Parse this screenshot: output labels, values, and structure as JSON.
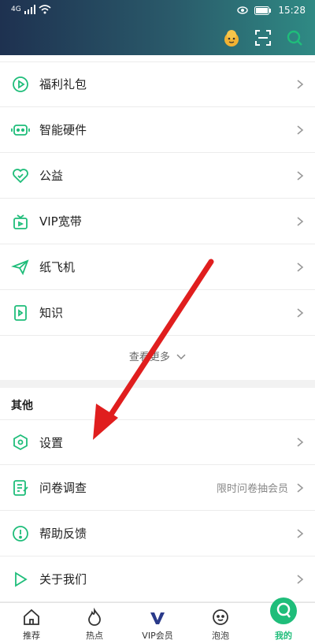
{
  "status_bar": {
    "network": "4G",
    "time": "15:28"
  },
  "menu": {
    "items": [
      {
        "label": "福利礼包",
        "icon": "gift-play-icon"
      },
      {
        "label": "智能硬件",
        "icon": "robot-device-icon"
      },
      {
        "label": "公益",
        "icon": "heart-check-icon"
      },
      {
        "label": "VIP宽带",
        "icon": "bandwidth-box-icon"
      },
      {
        "label": "纸飞机",
        "icon": "paper-plane-icon"
      },
      {
        "label": "知识",
        "icon": "book-play-icon"
      }
    ],
    "more_label": "查看更多"
  },
  "other": {
    "title": "其他",
    "items": [
      {
        "label": "设置",
        "icon": "hexagon-settings-icon",
        "extra": ""
      },
      {
        "label": "问卷调查",
        "icon": "survey-icon",
        "extra": "限时问卷抽会员"
      },
      {
        "label": "帮助反馈",
        "icon": "help-exclamation-icon",
        "extra": ""
      },
      {
        "label": "关于我们",
        "icon": "about-play-icon",
        "extra": ""
      }
    ]
  },
  "tabs": [
    {
      "label": "推荐",
      "icon": "home-icon"
    },
    {
      "label": "热点",
      "icon": "flame-icon"
    },
    {
      "label": "VIP会员",
      "icon": "vip-icon"
    },
    {
      "label": "泡泡",
      "icon": "bubble-face-icon"
    },
    {
      "label": "我的",
      "icon": "profile-icon"
    }
  ],
  "colors": {
    "accent": "#1fbd7a",
    "arrow": "#e01e1e"
  }
}
